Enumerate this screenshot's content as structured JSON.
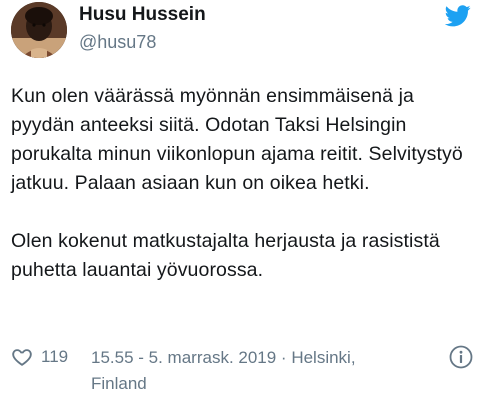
{
  "author": {
    "display_name": "Husu Hussein",
    "handle": "@husu78",
    "avatar_icon": "profile-photo"
  },
  "platform_icon": "twitter-bird-icon",
  "colors": {
    "brand": "#1da1f2",
    "text": "#14171a",
    "secondary": "#657786"
  },
  "tweet": {
    "paragraphs": [
      "Kun olen väärässä myönnän ensimmäisenä ja pyydän anteeksi siitä. Odotan Taksi Helsingin porukalta minun viikonlopun ajama reitit. Selvitystyö jatkuu. Palaan asiaan kun on oikea hetki.",
      "Olen kokenut matkustajalta herjausta ja rasististä puhetta lauantai yövuorossa."
    ]
  },
  "footer": {
    "like_count": "119",
    "timestamp": "15.55 - 5. marrask. 2019 · Helsinki, Finland",
    "info_icon": "info-icon"
  }
}
